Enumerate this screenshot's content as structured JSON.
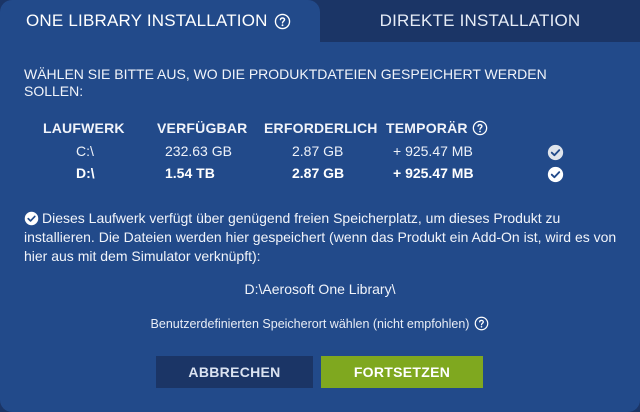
{
  "tabs": {
    "active_label": "ONE LIBRARY INSTALLATION",
    "inactive_label": "DIREKTE INSTALLATION"
  },
  "prompt": "WÄHLEN SIE BITTE AUS, WO DIE PRODUKTDATEIEN GESPEICHERT WERDEN SOLLEN:",
  "drives": {
    "headers": [
      "LAUFWERK",
      "VERFÜGBAR",
      "ERFORDERLICH",
      "TEMPORÄR"
    ],
    "rows": [
      {
        "drive": "C:\\",
        "available": "232.63 GB",
        "required": "2.87 GB",
        "temporary": "+ 925.47 MB",
        "selected": false
      },
      {
        "drive": "D:\\",
        "available": "1.54 TB",
        "required": "2.87 GB",
        "temporary": "+ 925.47 MB",
        "selected": true
      }
    ]
  },
  "info": "Dieses Laufwerk verfügt über genügend freien Speicherplatz, um dieses Produkt zu installieren. Die Dateien werden hier gespeichert (wenn das Produkt ein Add-On ist, wird es von hier aus mit dem Simulator verknüpft):",
  "install_path": "D:\\Aerosoft One Library\\",
  "custom_location": "Benutzerdefinierten Speicherort wählen (nicht empfohlen)",
  "buttons": {
    "cancel": "ABBRECHEN",
    "continue": "FORTSETZEN"
  },
  "colors": {
    "background": "#1b3566",
    "panel": "#224a8a",
    "continue_button": "#7fa81f",
    "cancel_button": "#1b3566"
  },
  "icons": {
    "help": "help-circle-icon",
    "check": "check-circle-icon"
  }
}
